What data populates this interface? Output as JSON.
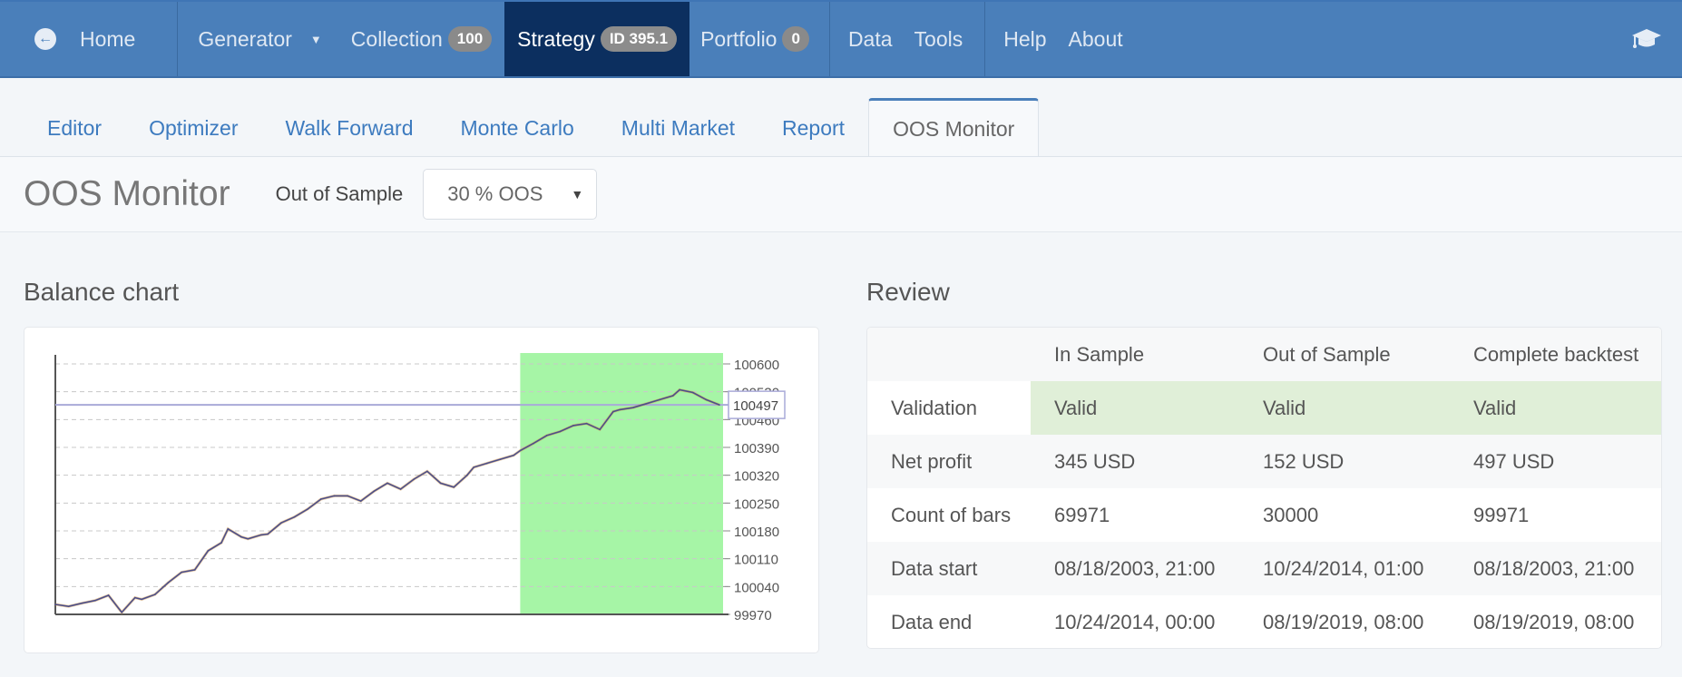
{
  "topnav": {
    "home": {
      "label": "Home",
      "icon": "arrow-left-circle-icon"
    },
    "generator": {
      "label": "Generator",
      "icon": "caret-down-icon"
    },
    "collection": {
      "label": "Collection",
      "badge": "100"
    },
    "strategy": {
      "label": "Strategy",
      "badge": "ID 395.1"
    },
    "portfolio": {
      "label": "Portfolio",
      "badge": "0"
    },
    "data": {
      "label": "Data"
    },
    "tools": {
      "label": "Tools"
    },
    "help": {
      "label": "Help"
    },
    "about": {
      "label": "About"
    },
    "right_icon": "graduation-cap-icon",
    "colors": {
      "bar": "#4a7fba",
      "active": "#0c2f5f",
      "badge": "#8a8a8a"
    }
  },
  "subtabs": [
    {
      "label": "Editor",
      "active": false
    },
    {
      "label": "Optimizer",
      "active": false
    },
    {
      "label": "Walk Forward",
      "active": false
    },
    {
      "label": "Monte Carlo",
      "active": false
    },
    {
      "label": "Multi Market",
      "active": false
    },
    {
      "label": "Report",
      "active": false
    },
    {
      "label": "OOS Monitor",
      "active": true
    }
  ],
  "toolbar": {
    "title": "OOS Monitor",
    "oos_label": "Out of Sample",
    "oos_selected": "30 % OOS"
  },
  "balance_section": {
    "title": "Balance chart"
  },
  "review_section": {
    "title": "Review",
    "columns": [
      "",
      "In Sample",
      "Out of Sample",
      "Complete backtest"
    ],
    "rows": [
      {
        "label": "Validation",
        "values": [
          "Valid",
          "Valid",
          "Valid"
        ],
        "status": "valid"
      },
      {
        "label": "Net profit",
        "values": [
          "345 USD",
          "152 USD",
          "497 USD"
        ]
      },
      {
        "label": "Count of bars",
        "values": [
          "69971",
          "30000",
          "99971"
        ]
      },
      {
        "label": "Data start",
        "values": [
          "08/18/2003, 21:00",
          "10/24/2014, 01:00",
          "08/18/2003, 21:00"
        ]
      },
      {
        "label": "Data end",
        "values": [
          "10/24/2014, 00:00",
          "08/19/2019, 08:00",
          "08/19/2019, 08:00"
        ]
      }
    ],
    "colors": {
      "valid_bg": "#e0efd8"
    }
  },
  "chart_data": {
    "type": "line",
    "title": "Balance chart",
    "xlabel": "",
    "ylabel": "",
    "ylim": [
      99970,
      100600
    ],
    "y_ticks": [
      99970,
      100040,
      100110,
      100180,
      100250,
      100320,
      100390,
      100460,
      100530,
      100600
    ],
    "y_axis_position": "right",
    "grid": true,
    "current_value_marker": 100497,
    "oos_region": {
      "from_fraction": 0.7,
      "to_fraction": 1.0,
      "color": "#a6f5a6"
    },
    "series": [
      {
        "name": "Balance",
        "color": "#4b4f8a",
        "x_fraction": [
          0.0,
          0.02,
          0.04,
          0.06,
          0.08,
          0.1,
          0.12,
          0.13,
          0.15,
          0.17,
          0.19,
          0.21,
          0.23,
          0.25,
          0.26,
          0.28,
          0.29,
          0.31,
          0.32,
          0.34,
          0.36,
          0.38,
          0.4,
          0.42,
          0.44,
          0.46,
          0.48,
          0.5,
          0.52,
          0.54,
          0.56,
          0.58,
          0.6,
          0.62,
          0.63,
          0.65,
          0.67,
          0.69,
          0.7,
          0.72,
          0.74,
          0.76,
          0.78,
          0.8,
          0.82,
          0.84,
          0.85,
          0.87,
          0.89,
          0.91,
          0.93,
          0.94,
          0.96,
          0.98,
          1.0
        ],
        "values": [
          99995,
          99990,
          99998,
          100005,
          100018,
          99975,
          100012,
          100008,
          100020,
          100050,
          100076,
          100082,
          100130,
          100150,
          100185,
          100165,
          100160,
          100170,
          100172,
          100200,
          100215,
          100235,
          100260,
          100268,
          100268,
          100255,
          100280,
          100300,
          100285,
          100310,
          100330,
          100300,
          100290,
          100320,
          100340,
          100350,
          100360,
          100370,
          100382,
          100400,
          100420,
          100430,
          100445,
          100450,
          100435,
          100480,
          100485,
          100490,
          100500,
          100510,
          100520,
          100535,
          100528,
          100510,
          100497
        ]
      }
    ]
  }
}
